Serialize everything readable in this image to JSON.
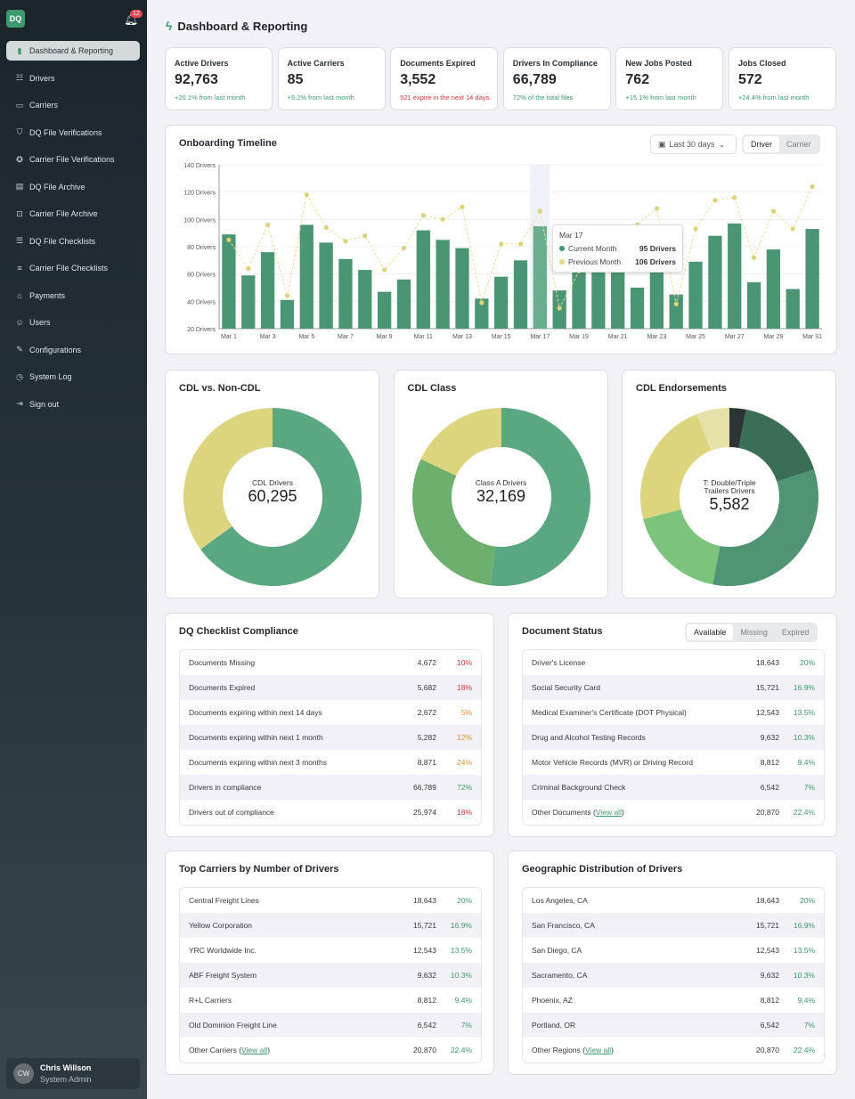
{
  "colors": {
    "accent": "#3d9a6e",
    "bar": "#4a9574",
    "bar_highlight": "#6aae8e",
    "previous": "#e3d98a",
    "red": "#d9363e",
    "orange": "#e8913a",
    "green": "#3d9a6e"
  },
  "sidebar": {
    "logo": "DQ",
    "notifications": "12",
    "items": [
      {
        "label": "Dashboard & Reporting",
        "icon": "bar-chart-icon",
        "glyph": "▮",
        "active": true
      },
      {
        "label": "Drivers",
        "icon": "users-icon",
        "glyph": "☷"
      },
      {
        "label": "Carriers",
        "icon": "truck-icon",
        "glyph": "▭"
      },
      {
        "label": "DQ File Verifications",
        "icon": "shield-check-icon",
        "glyph": "⛉"
      },
      {
        "label": "Carrier File Verifications",
        "icon": "badge-check-icon",
        "glyph": "✪"
      },
      {
        "label": "DQ File Archive",
        "icon": "archive-icon",
        "glyph": "▤"
      },
      {
        "label": "Carrier File Archive",
        "icon": "archive-download-icon",
        "glyph": "⊡"
      },
      {
        "label": "DQ File Checklists",
        "icon": "list-plus-icon",
        "glyph": "☰"
      },
      {
        "label": "Carrier File Checklists",
        "icon": "list-icon",
        "glyph": "≡"
      },
      {
        "label": "Payments",
        "icon": "bank-icon",
        "glyph": "⌂"
      },
      {
        "label": "Users",
        "icon": "user-search-icon",
        "glyph": "☺"
      },
      {
        "label": "Configurations",
        "icon": "wrench-icon",
        "glyph": "✎"
      },
      {
        "label": "System Log",
        "icon": "clock-icon",
        "glyph": "◷"
      },
      {
        "label": "Sign out",
        "icon": "sign-out-icon",
        "glyph": "⇥"
      }
    ],
    "user": {
      "initials": "CW",
      "name": "Chris Willson",
      "role": "System Admin"
    }
  },
  "header": {
    "title": "Dashboard & Reporting"
  },
  "stats": [
    {
      "label": "Active Drivers",
      "value": "92,763",
      "sub": "+20.1% from last month",
      "tone": "green"
    },
    {
      "label": "Active Carriers",
      "value": "85",
      "sub": "+5.2% from last month",
      "tone": "green"
    },
    {
      "label": "Documents Expired",
      "value": "3,552",
      "sub": "521 expire in the next 14 days",
      "tone": "red"
    },
    {
      "label": "Drivers In Compliance",
      "value": "66,789",
      "sub": "72% of the total files",
      "tone": "green"
    },
    {
      "label": "New Jobs Posted",
      "value": "762",
      "sub": "+15.1% from last month",
      "tone": "green"
    },
    {
      "label": "Jobs Closed",
      "value": "572",
      "sub": "+24.4% from last month",
      "tone": "green"
    }
  ],
  "timeline": {
    "title": "Onboarding Timeline",
    "range": "Last 30 days",
    "toggle": [
      "Driver",
      "Carrier"
    ],
    "toggle_selected": "Driver",
    "tooltip": {
      "date": "Mar 17",
      "current_label": "Current Month",
      "current_value": "95 Drivers",
      "previous_label": "Previous Month",
      "previous_value": "106 Drivers"
    }
  },
  "chart_data": [
    {
      "type": "bar",
      "title": "Onboarding Timeline",
      "ylim": [
        20,
        140
      ],
      "yticks": [
        "20 Drivers",
        "40 Drivers",
        "60 Drivers",
        "80 Drivers",
        "100 Drivers",
        "120 Drivers",
        "140 Drivers"
      ],
      "xtick_labels": [
        "Mar 1",
        "Mar 3",
        "Mar 5",
        "Mar 7",
        "Mar 9",
        "Mar 11",
        "Mar 13",
        "Mar 15",
        "Mar 17",
        "Mar 19",
        "Mar 21",
        "Mar 23",
        "Mar 25",
        "Mar 27",
        "Mar 29",
        "Mar 31"
      ],
      "categories": [
        "Mar 1",
        "Mar 2",
        "Mar 3",
        "Mar 4",
        "Mar 5",
        "Mar 6",
        "Mar 7",
        "Mar 8",
        "Mar 9",
        "Mar 10",
        "Mar 11",
        "Mar 12",
        "Mar 13",
        "Mar 14",
        "Mar 15",
        "Mar 16",
        "Mar 17",
        "Mar 18",
        "Mar 19",
        "Mar 20",
        "Mar 21",
        "Mar 22",
        "Mar 23",
        "Mar 24",
        "Mar 25",
        "Mar 26",
        "Mar 27",
        "Mar 28",
        "Mar 29",
        "Mar 30",
        "Mar 31"
      ],
      "series": [
        {
          "name": "Current Month",
          "type": "bar",
          "values": [
            89,
            59,
            76,
            41,
            96,
            83,
            71,
            63,
            47,
            56,
            92,
            85,
            79,
            42,
            58,
            70,
            95,
            48,
            65,
            70,
            68,
            50,
            64,
            45,
            69,
            88,
            97,
            54,
            78,
            49,
            93
          ]
        },
        {
          "name": "Previous Month",
          "type": "line",
          "values": [
            85,
            64,
            96,
            44,
            118,
            94,
            84,
            88,
            63,
            79,
            103,
            100,
            109,
            39,
            82,
            82,
            106,
            35,
            62,
            80,
            92,
            96,
            108,
            38,
            93,
            114,
            116,
            72,
            106,
            93,
            124
          ]
        }
      ],
      "highlight": "Mar 17",
      "grid": true
    },
    {
      "type": "pie",
      "title": "CDL vs. Non-CDL",
      "center_label": "CDL Drivers",
      "center_value": "60,295",
      "shares": [
        65,
        35
      ],
      "colors": [
        "#5aa882",
        "#dcd57e"
      ]
    },
    {
      "type": "pie",
      "title": "CDL Class",
      "center_label": "Class A Drivers",
      "center_value": "32,169",
      "shares": [
        52,
        30,
        18
      ],
      "colors": [
        "#5aa882",
        "#6db06e",
        "#dcd57e"
      ]
    },
    {
      "type": "pie",
      "title": "CDL Endorsements",
      "center_label": "T: Double/Triple Trailers Drivers",
      "center_value": "5,582",
      "shares": [
        3,
        17,
        33,
        18,
        23,
        6
      ],
      "colors": [
        "#2d3436",
        "#3a6e55",
        "#4f9574",
        "#7cc47c",
        "#dcd57e",
        "#e6e1a6"
      ]
    }
  ],
  "tables": [
    {
      "title": "DQ Checklist Compliance",
      "rows": [
        [
          "Documents Missing",
          "4,672",
          "10%",
          "red"
        ],
        [
          "Documents Expired",
          "5,682",
          "18%",
          "red"
        ],
        [
          "Documents expiring within next 14 days",
          "2,672",
          "5%",
          "orange"
        ],
        [
          "Documents expiring within next 1 month",
          "5,282",
          "12%",
          "orange"
        ],
        [
          "Documents expiring within next 3 months",
          "8,871",
          "24%",
          "orange"
        ],
        [
          "Drivers in compliance",
          "66,789",
          "72%",
          "green"
        ],
        [
          "Drivers out of compliance",
          "25,974",
          "18%",
          "red"
        ]
      ]
    },
    {
      "title": "Document Status",
      "tabs": [
        "Available",
        "Missing",
        "Expired"
      ],
      "tab_selected": "Available",
      "rows": [
        [
          "Driver's License",
          "18,643",
          "20%",
          "green"
        ],
        [
          "Social Security Card",
          "15,721",
          "16.9%",
          "green"
        ],
        [
          "Medical Examiner's Certificate (DOT Physical)",
          "12,543",
          "13.5%",
          "green"
        ],
        [
          "Drug and Alcohol Testing Records",
          "9,632",
          "10.3%",
          "green"
        ],
        [
          "Motor Vehicle Records (MVR) or Driving Record",
          "8,812",
          "9.4%",
          "green"
        ],
        [
          "Criminal Background Check",
          "6,542",
          "7%",
          "green"
        ],
        [
          "Other Documents",
          "20,870",
          "22.4%",
          "green",
          "View all"
        ]
      ]
    },
    {
      "title": "Top Carriers by Number of Drivers",
      "rows": [
        [
          "Central Freight Lines",
          "18,643",
          "20%",
          "green"
        ],
        [
          "Yellow Corporation",
          "15,721",
          "16.9%",
          "green"
        ],
        [
          "YRC Worldwide Inc.",
          "12,543",
          "13.5%",
          "green"
        ],
        [
          "ABF Freight System",
          "9,632",
          "10.3%",
          "green"
        ],
        [
          "R+L Carriers",
          "8,812",
          "9.4%",
          "green"
        ],
        [
          "Old Dominion Freight Line",
          "6,542",
          "7%",
          "green"
        ],
        [
          "Other Carriers",
          "20,870",
          "22.4%",
          "green",
          "View all"
        ]
      ]
    },
    {
      "title": "Geographic Distribution of Drivers",
      "rows": [
        [
          "Los Angeles, CA",
          "18,643",
          "20%",
          "green"
        ],
        [
          "San Francisco, CA",
          "15,721",
          "16.9%",
          "green"
        ],
        [
          "San Diego, CA",
          "12,543",
          "13.5%",
          "green"
        ],
        [
          "Sacramento, CA",
          "9,632",
          "10.3%",
          "green"
        ],
        [
          "Phoenix, AZ",
          "8,812",
          "9.4%",
          "green"
        ],
        [
          "Portland, OR",
          "6,542",
          "7%",
          "green"
        ],
        [
          "Other Regions",
          "20,870",
          "22.4%",
          "green",
          "View all"
        ]
      ]
    }
  ]
}
